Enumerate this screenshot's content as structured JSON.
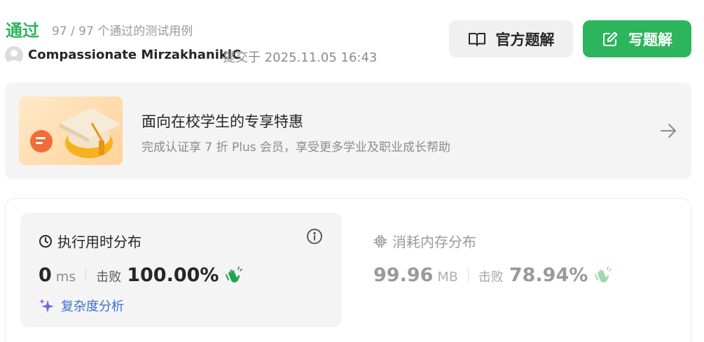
{
  "header": {
    "status": "通过",
    "passed_cases": "97 / 97 个通过的测试用例",
    "username": "Compassionate MirzakhanikiC",
    "submitted_at": "提交于 2025.11.05 16:43"
  },
  "buttons": {
    "official_solution": "官方题解",
    "write_solution": "写题解"
  },
  "promo": {
    "title": "面向在校学生的专享特惠",
    "subtitle": "完成认证享 7 折 Plus 会员，享受更多学业及职业成长帮助"
  },
  "runtime": {
    "title": "执行用时分布",
    "value": "0",
    "unit": "ms",
    "beats_label": "击败",
    "beats_value": "100.00%",
    "complexity_link": "复杂度分析"
  },
  "memory": {
    "title": "消耗内存分布",
    "value": "99.96",
    "unit": "MB",
    "beats_label": "击败",
    "beats_value": "78.94%"
  },
  "colors": {
    "accent_green": "#2db55d",
    "link_blue": "#3b6fd6",
    "muted": "#9a9a9a"
  },
  "icons": [
    "user-avatar-icon",
    "book-icon",
    "edit-icon",
    "graduation-cap-icon",
    "arrow-right-icon",
    "clock-icon",
    "info-icon",
    "clapping-hands-icon",
    "sparkle-icon",
    "chip-icon"
  ]
}
